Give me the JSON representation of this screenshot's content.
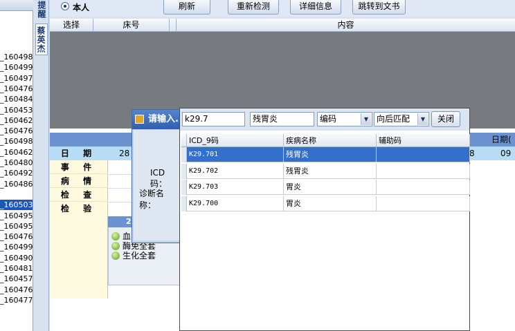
{
  "left_list": {
    "items": [
      {
        "text": "_160498",
        "selected": false
      },
      {
        "text": "_160499",
        "selected": false
      },
      {
        "text": "_160497",
        "selected": false
      },
      {
        "text": "_160476",
        "selected": false
      },
      {
        "text": "_160484",
        "selected": false
      },
      {
        "text": "_160453",
        "selected": false
      },
      {
        "text": "_160462",
        "selected": false
      },
      {
        "text": "_160476",
        "selected": false
      },
      {
        "text": "_160498",
        "selected": false
      },
      {
        "text": "_160462",
        "selected": false
      },
      {
        "text": "_160480",
        "selected": false
      },
      {
        "text": "_160492",
        "selected": false
      },
      {
        "text": "_160486",
        "selected": false
      },
      {
        "text": "",
        "selected": false
      },
      {
        "text": "_160503",
        "selected": true
      },
      {
        "text": "_160495",
        "selected": false
      },
      {
        "text": "_160495",
        "selected": false
      },
      {
        "text": "_160476",
        "selected": false
      },
      {
        "text": "_160499",
        "selected": false
      },
      {
        "text": "_160490",
        "selected": false
      },
      {
        "text": "_160481",
        "selected": false
      },
      {
        "text": "_160457",
        "selected": false
      },
      {
        "text": "_160476",
        "selected": false
      },
      {
        "text": "_160477",
        "selected": false
      }
    ]
  },
  "vtabs": {
    "remind": "提醒",
    "person": "蔡英杰"
  },
  "toolbar": {
    "radio_label": "本人",
    "refresh": "刷新",
    "recheck": "重新检测",
    "details": "详细信息",
    "jump_doc": "跳转到文书"
  },
  "grid": {
    "col_select": "选择",
    "col_bed": "床号",
    "col_content": "内容"
  },
  "schedule": {
    "date_label": "日 期",
    "date_first": "28",
    "date_right_a": "8",
    "date_right_b": "09",
    "right_header": "日期(",
    "rows": [
      "事 件",
      "病 情",
      "检 查",
      "检 验"
    ],
    "sub_head": "2",
    "sub_items": [
      "血",
      "酶免全套",
      "生化全套"
    ]
  },
  "dialog": {
    "title": "请输入.",
    "icd_label": "ICD码：",
    "diag_label": "诊断名称："
  },
  "popup": {
    "code_input": "k29.7",
    "name_input": "残胃炎",
    "search_by": "编码",
    "match_mode": "向后匹配",
    "close": "关闭",
    "headers": [
      "ICD_9码",
      "疾病名称",
      "辅助码"
    ],
    "rows": [
      {
        "code": "K29.701",
        "name": "残胃炎",
        "aux": "",
        "selected": true
      },
      {
        "code": "K29.702",
        "name": "残胃炎",
        "aux": "",
        "selected": false
      },
      {
        "code": "K29.703",
        "name": "胃炎",
        "aux": "",
        "selected": false
      },
      {
        "code": "K29.700",
        "name": "胃炎",
        "aux": "",
        "selected": false
      }
    ]
  }
}
